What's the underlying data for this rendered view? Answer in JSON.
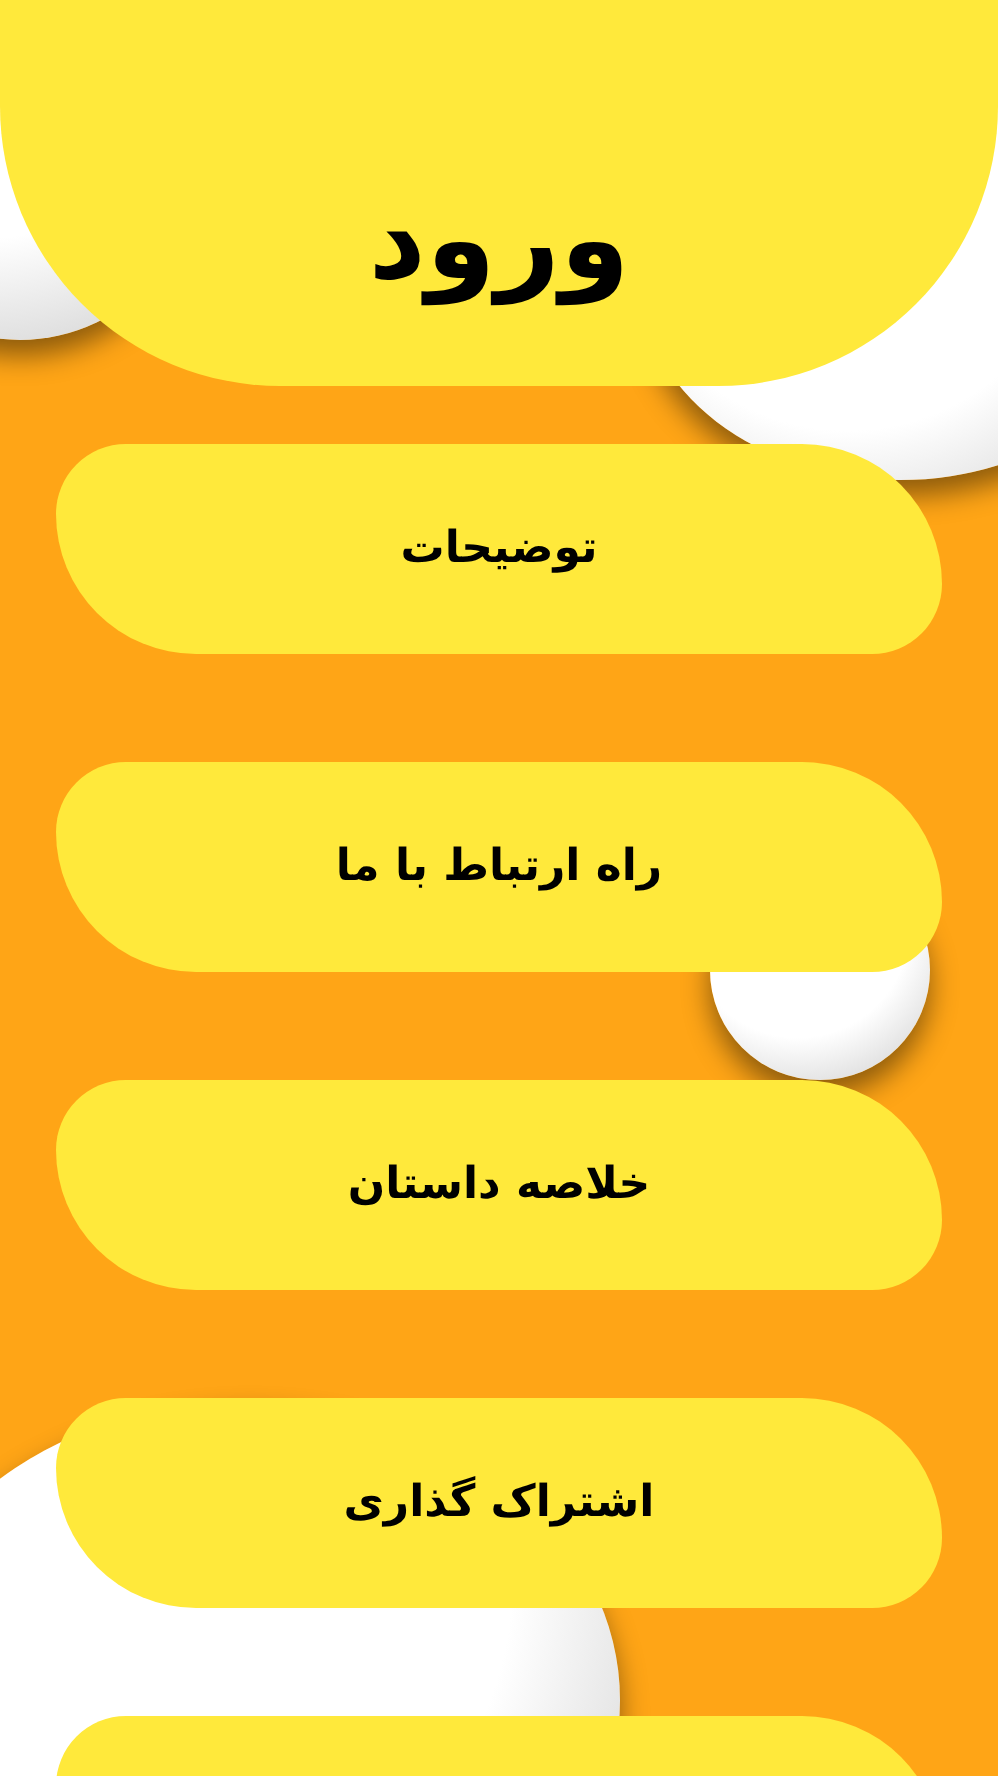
{
  "header": {
    "title": "ورود"
  },
  "menu": [
    {
      "label": "توضیحات"
    },
    {
      "label": "راه ارتباط با ما"
    },
    {
      "label": "خلاصه داستان"
    },
    {
      "label": "اشتراک گذاری"
    }
  ]
}
